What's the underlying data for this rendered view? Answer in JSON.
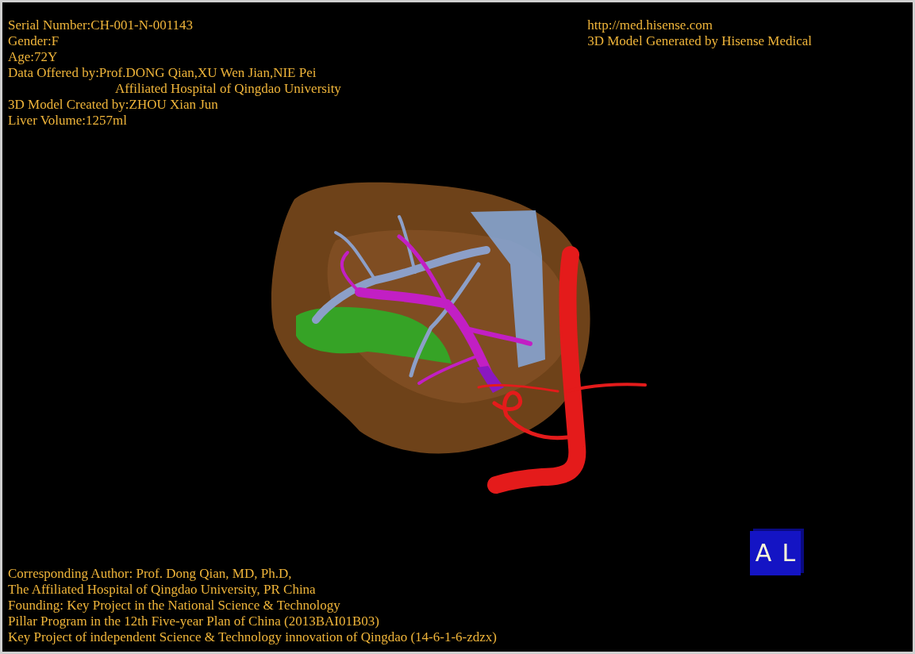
{
  "header_left": [
    {
      "text": "Serial Number:CH-001-N-001143",
      "kind": "line"
    },
    {
      "text": "Gender:F",
      "kind": "line"
    },
    {
      "text": "Age:72Y",
      "kind": "line"
    },
    {
      "text": "Data Offered by:Prof.DONG Qian,XU Wen Jian,NIE Pei",
      "kind": "line"
    },
    {
      "text": "Affiliated Hospital of Qingdao University",
      "kind": "continuation"
    },
    {
      "text": "3D Model Created by:ZHOU Xian Jun",
      "kind": "line"
    },
    {
      "text": "Liver Volume:1257ml",
      "kind": "line"
    }
  ],
  "header_right": [
    {
      "text": "http://med.hisense.com",
      "kind": "line"
    },
    {
      "text": "3D Model Generated by Hisense Medical",
      "kind": "line"
    }
  ],
  "footer": [
    {
      "text": "Corresponding Author: Prof. Dong Qian, MD, Ph.D,",
      "kind": "line"
    },
    {
      "text": "The Affiliated Hospital of Qingdao University, PR China",
      "kind": "line"
    },
    {
      "text": "Founding: Key Project in the National Science & Technology",
      "kind": "line"
    },
    {
      "text": "Pillar Program in the 12th Five-year Plan of China (2013BAI01B03)",
      "kind": "line"
    },
    {
      "text": "Key Project of independent Science & Technology innovation of Qingdao (14-6-1-6-zdzx)",
      "kind": "line"
    }
  ],
  "orientation_cube": {
    "faces": [
      "A",
      "L"
    ]
  }
}
